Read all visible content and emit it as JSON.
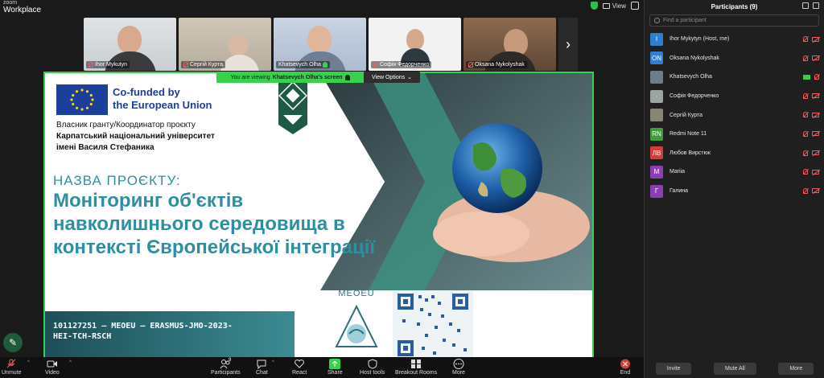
{
  "app": {
    "brand_small": "zoom",
    "brand_big": "Workplace",
    "view_label": "View"
  },
  "thumbnails": [
    {
      "name": "Ihor Mykutyn"
    },
    {
      "name": "Сергій Курта"
    },
    {
      "name": "Khatsevych Olha"
    },
    {
      "name": "Софія Федорченко"
    },
    {
      "name": "Oksana Nykolyshak"
    }
  ],
  "share": {
    "prefix": "You are viewing",
    "presenter": "Khatsevych Olha's screen",
    "view_options": "View Options"
  },
  "slide": {
    "cofunded_line1": "Co-funded by",
    "cofunded_line2": "the European Union",
    "grantee_line1": "Власник гранту/Координатор проєкту",
    "grantee_line2": "Карпатський національний університет",
    "grantee_line3": "імені Василя Стефаника",
    "project_label": "НАЗВА ПРОЄКТУ:",
    "project_title": "Моніторинг об'єктів навколишнього середовища в контексті Європейської інтеграції",
    "code": "101127251 — MEOEU — ERASMUS-JMO-2023-HEI-TCH-RSCH",
    "meoeu": "MEOEU"
  },
  "toolbar": {
    "unmute": "Unmute",
    "video": "Video",
    "participants": "Participants",
    "participants_count": "9",
    "chat": "Chat",
    "react": "React",
    "share": "Share",
    "host_tools": "Host tools",
    "breakout": "Breakout Rooms",
    "more": "More",
    "end": "End"
  },
  "panel": {
    "title": "Participants (9)",
    "search_placeholder": "Find a participant",
    "participants": [
      {
        "initials": "I",
        "name": "Ihor Mykytyn (Host, me)",
        "color": "#2d7fd3",
        "video": false
      },
      {
        "initials": "ON",
        "name": "Oksana Nykolyshak",
        "color": "#2d7fd3",
        "video": false
      },
      {
        "initials": "",
        "name": "Khatsevych Olha",
        "color": "#6a7f8a",
        "video": true
      },
      {
        "initials": "",
        "name": "Софія Федорченко",
        "color": "#9aa6a0",
        "video": false
      },
      {
        "initials": "",
        "name": "Сергій Курта",
        "color": "#8a8378",
        "video": false
      },
      {
        "initials": "RN",
        "name": "Redmi Note 11",
        "color": "#3f9b3f",
        "video": false
      },
      {
        "initials": "ЛВ",
        "name": "Любов Вирстюк",
        "color": "#d83b3b",
        "video": false
      },
      {
        "initials": "M",
        "name": "Mariia",
        "color": "#8a3fb5",
        "video": false
      },
      {
        "initials": "Г",
        "name": "Галина",
        "color": "#8a3fb5",
        "video": false
      }
    ],
    "invite": "Invite",
    "mute_all": "Mute All",
    "more": "More"
  },
  "colors": {
    "accent_green": "#37d14d",
    "slide_teal": "#2e8fa3",
    "eu_blue": "#1b3f9b",
    "mute_red": "#ff5a5a"
  }
}
